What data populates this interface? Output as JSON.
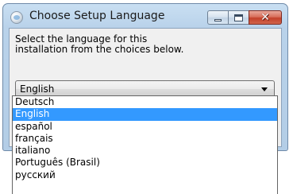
{
  "window": {
    "title": "Choose Setup Language",
    "icon": "setup-globe-icon"
  },
  "caption_buttons": {
    "minimize": "minimize-icon",
    "maximize": "maximize-icon",
    "close": "close-icon",
    "close_glyph": "✕"
  },
  "dialog": {
    "prompt_line1": "Select the language for this",
    "prompt_line2": "installation from the choices below."
  },
  "language_select": {
    "selected": "English",
    "options": [
      "Deutsch",
      "English",
      "español",
      "français",
      "italiano",
      "Português (Brasil)",
      "русский"
    ],
    "highlighted_index": 1
  },
  "colors": {
    "selection": "#3399ff",
    "close_button": "#c2402a",
    "titlebar": "#c9dff2"
  }
}
